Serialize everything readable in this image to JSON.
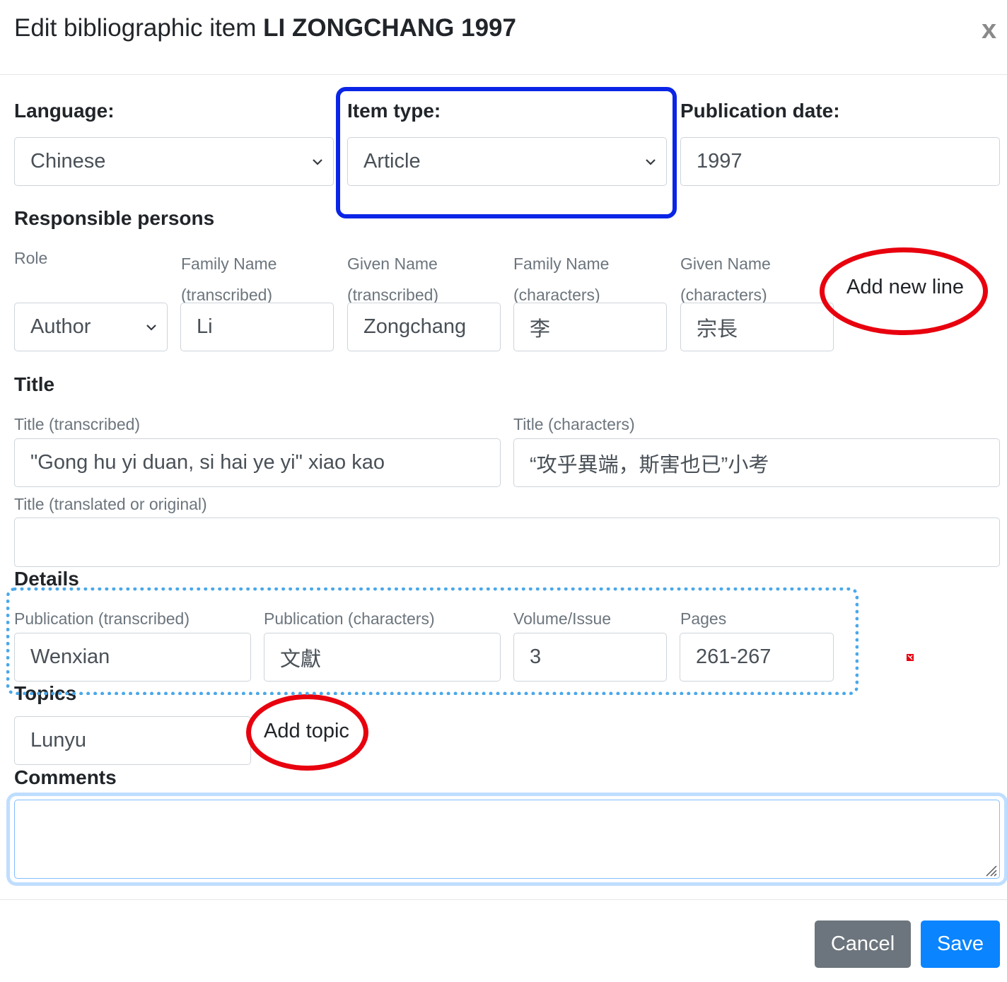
{
  "modal": {
    "title_prefix": "Edit bibliographic item",
    "title_item": "LI ZONGCHANG 1997",
    "close_label": "x"
  },
  "language": {
    "label": "Language:",
    "value": "Chinese"
  },
  "item_type": {
    "label": "Item type:",
    "value": "Article"
  },
  "publication_date": {
    "label": "Publication date:",
    "value": "1997"
  },
  "responsible_persons": {
    "heading": "Responsible persons",
    "headers": {
      "role": "Role",
      "family_tr_1": "Family Name",
      "family_tr_2": "(transcribed)",
      "given_tr_1": "Given Name",
      "given_tr_2": "(transcribed)",
      "family_ch_1": "Family Name",
      "family_ch_2": "(characters)",
      "given_ch_1": "Given Name",
      "given_ch_2": "(characters)"
    },
    "row": {
      "role": "Author",
      "family_transcribed": "Li",
      "given_transcribed": "Zongchang",
      "family_characters": "李",
      "given_characters": "宗長"
    },
    "add_line_label": "Add new line"
  },
  "title_section": {
    "heading": "Title",
    "transcribed_label": "Title (transcribed)",
    "transcribed_value": "\"Gong hu yi duan, si hai ye yi\" xiao kao",
    "characters_label": "Title (characters)",
    "characters_value": "“攻乎異端，斯害也已”小考",
    "translated_label": "Title (translated or original)",
    "translated_value": ""
  },
  "details": {
    "heading": "Details",
    "pub_transcribed_label": "Publication (transcribed)",
    "pub_transcribed_value": "Wenxian",
    "pub_characters_label": "Publication (characters)",
    "pub_characters_value": "文獻",
    "volume_label": "Volume/Issue",
    "volume_value": "3",
    "pages_label": "Pages",
    "pages_value": "261-267"
  },
  "topics": {
    "heading": "Topics",
    "value": "Lunyu",
    "add_label": "Add topic"
  },
  "comments": {
    "heading": "Comments",
    "value": ""
  },
  "footer": {
    "cancel_label": "Cancel",
    "save_label": "Save"
  },
  "colors": {
    "save_button": "#0a84ff",
    "cancel_button": "#6c757d",
    "annotation_blue": "#0a25e6",
    "annotation_red": "#e8000e",
    "annotation_dotted": "#4aa8ea"
  }
}
